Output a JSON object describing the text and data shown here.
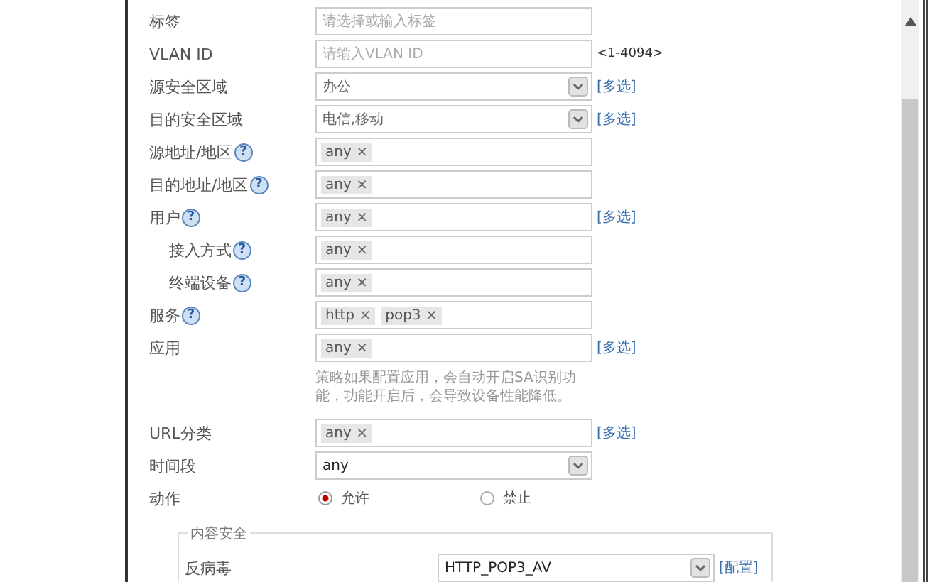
{
  "rows": [
    {
      "label": "标签",
      "kind": "text",
      "placeholder": "请选择或输入标签"
    },
    {
      "label": "VLAN ID",
      "kind": "text",
      "placeholder": "请输入VLAN ID",
      "suffix": "<1-4094>"
    },
    {
      "label": "源安全区域",
      "kind": "select",
      "value": "办公",
      "link": "[多选]"
    },
    {
      "label": "目的安全区域",
      "kind": "select",
      "value": "电信,移动",
      "link": "[多选]"
    },
    {
      "label": "源地址/地区",
      "help": "?",
      "kind": "tags",
      "tags": [
        {
          "label": "any",
          "remove": "×"
        }
      ]
    },
    {
      "label": "目的地址/地区",
      "help": "?",
      "kind": "tags",
      "tags": [
        {
          "label": "any",
          "remove": "×"
        }
      ]
    },
    {
      "label": "用户",
      "help": "?",
      "kind": "tags",
      "tags": [
        {
          "label": "any",
          "remove": "×"
        }
      ],
      "link": "[多选]"
    },
    {
      "label": "接入方式",
      "help": "?",
      "indent": true,
      "kind": "tags",
      "tags": [
        {
          "label": "any",
          "remove": "×"
        }
      ]
    },
    {
      "label": "终端设备",
      "help": "?",
      "indent": true,
      "kind": "tags",
      "tags": [
        {
          "label": "any",
          "remove": "×"
        }
      ]
    },
    {
      "label": "服务",
      "help": "?",
      "kind": "tags",
      "tags": [
        {
          "label": "http",
          "remove": "×"
        },
        {
          "label": "pop3",
          "remove": "×"
        }
      ]
    },
    {
      "label": "应用",
      "kind": "tags",
      "tags": [
        {
          "label": "any",
          "remove": "×"
        }
      ],
      "link": "[多选]",
      "note": "策略如果配置应用，会自动开启SA识别功能，功能开启后，会导致设备性能降低。"
    },
    {
      "label": "URL分类",
      "kind": "tags",
      "tags": [
        {
          "label": "any",
          "remove": "×"
        }
      ],
      "link": "[多选]"
    },
    {
      "label": "时间段",
      "kind": "select",
      "value": "any",
      "plain": true
    },
    {
      "label": "动作",
      "kind": "radio",
      "options": [
        {
          "label": "允许",
          "selected": true
        },
        {
          "label": "禁止",
          "selected": false
        }
      ]
    }
  ],
  "section": {
    "legend": "内容安全",
    "rows": [
      {
        "label": "反病毒",
        "kind": "select",
        "value": "HTTP_POP3_AV",
        "plain": true,
        "link": "[配置]"
      }
    ]
  }
}
